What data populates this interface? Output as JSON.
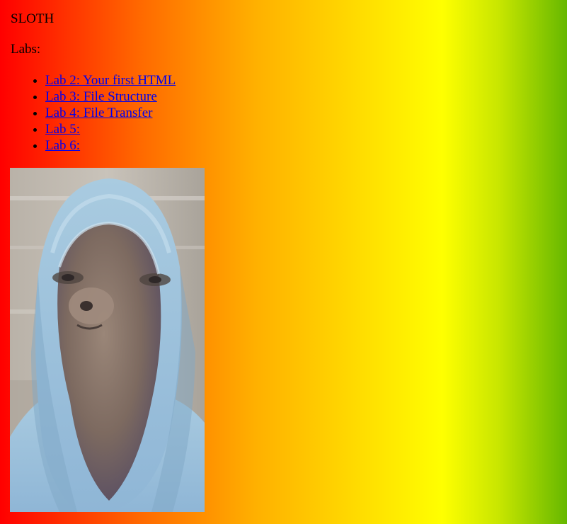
{
  "page": {
    "title": "SLOTH",
    "labs_heading": "Labs:"
  },
  "labs": [
    {
      "label": "Lab 2: Your first HTML"
    },
    {
      "label": "Lab 3: File Structure"
    },
    {
      "label": "Lab 4: File Transfer"
    },
    {
      "label": "Lab 5:"
    },
    {
      "label": "Lab 6:"
    }
  ],
  "image": {
    "subject": "sloth wearing a light blue hoodie",
    "icon": "sloth-hoodie-photo"
  },
  "colors": {
    "gradient": [
      "#ff0000",
      "#ff6a00",
      "#ffb000",
      "#ffe000",
      "#ffff00",
      "#c8e600",
      "#66b800"
    ],
    "link": "#0000ee"
  }
}
